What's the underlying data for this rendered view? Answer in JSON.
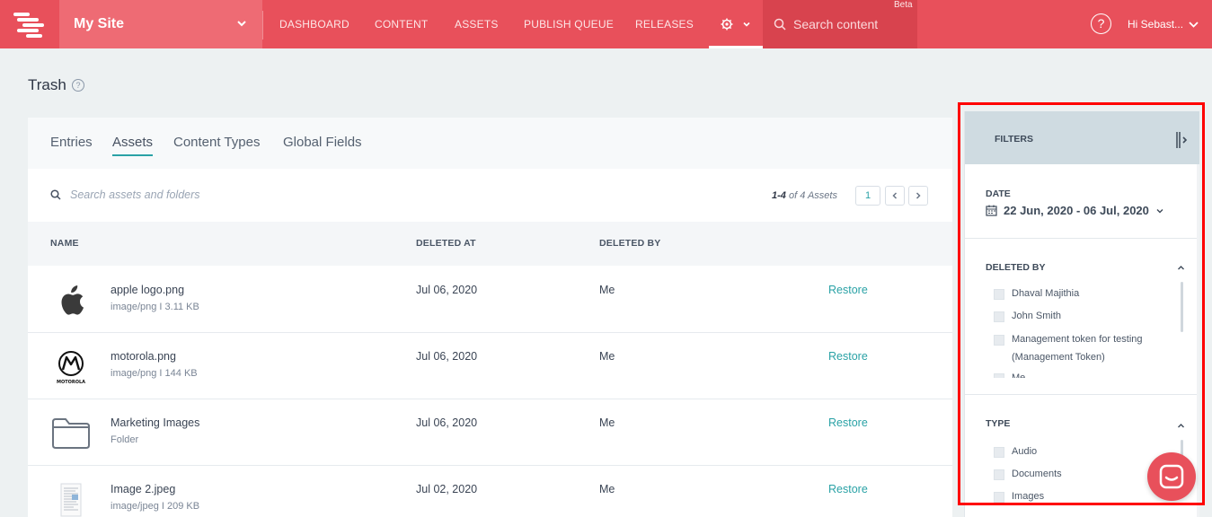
{
  "nav": {
    "site_name": "My Site",
    "items": [
      "DASHBOARD",
      "CONTENT",
      "ASSETS",
      "PUBLISH QUEUE",
      "RELEASES"
    ],
    "search_placeholder": "Search content",
    "beta_badge": "Beta",
    "help_glyph": "?",
    "user_greeting": "Hi  Sebast..."
  },
  "page": {
    "title": "Trash",
    "help_glyph": "?"
  },
  "tabs": [
    "Entries",
    "Assets",
    "Content Types",
    "Global Fields"
  ],
  "active_tab": "Assets",
  "toolbar": {
    "search_placeholder": "Search assets and folders",
    "count_range": "1-4",
    "count_suffix": " of 4 Assets",
    "page_number": "1"
  },
  "table": {
    "headers": [
      "NAME",
      "DELETED AT",
      "DELETED BY"
    ],
    "rows": [
      {
        "name": "apple logo.png",
        "meta": "image/png  I 3.11 KB",
        "deleted_at": "Jul 06, 2020",
        "deleted_by": "Me",
        "action": "Restore",
        "icon": "apple-logo-icon"
      },
      {
        "name": "motorola.png",
        "meta": "image/png  I 144 KB",
        "deleted_at": "Jul 06, 2020",
        "deleted_by": "Me",
        "action": "Restore",
        "icon": "motorola-logo-icon"
      },
      {
        "name": "Marketing Images",
        "meta": "Folder",
        "deleted_at": "Jul 06, 2020",
        "deleted_by": "Me",
        "action": "Restore",
        "icon": "folder-icon"
      },
      {
        "name": "Image 2.jpeg",
        "meta": "image/jpeg  I 209 KB",
        "deleted_at": "Jul 02, 2020",
        "deleted_by": "Me",
        "action": "Restore",
        "icon": "document-thumbnail-icon"
      }
    ],
    "thumb_labels": {
      "motorola": "MOTOROLA"
    }
  },
  "filters": {
    "title": "FILTERS",
    "date_label": "DATE",
    "date_value": "22 Jun, 2020 - 06 Jul, 2020",
    "deleted_by_label": "DELETED BY",
    "deleted_by_options": [
      "Dhaval Majithia",
      "John Smith",
      "Management token for testing (Management Token)",
      "Me"
    ],
    "type_label": "TYPE",
    "type_options": [
      "Audio",
      "Documents",
      "Images"
    ]
  },
  "colors": {
    "brand": "#e8505b",
    "accent": "#2aa2a6",
    "highlight": "#ff0000"
  }
}
